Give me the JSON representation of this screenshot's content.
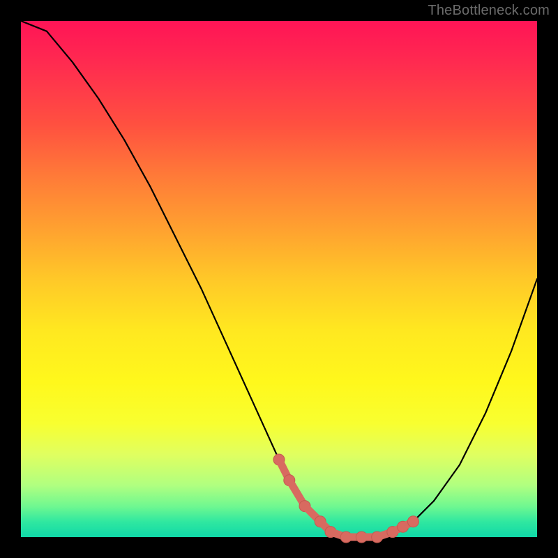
{
  "watermark": "TheBottleneck.com",
  "colors": {
    "frame": "#000000",
    "curve_black": "#000000",
    "marker": "#d86a60",
    "marker_stroke": "#c45a50"
  },
  "chart_data": {
    "type": "line",
    "title": "",
    "xlabel": "",
    "ylabel": "",
    "xlim": [
      0,
      100
    ],
    "ylim": [
      0,
      100
    ],
    "grid": false,
    "legend": false,
    "series": [
      {
        "name": "bottleneck-curve",
        "x": [
          0,
          5,
          10,
          15,
          20,
          25,
          30,
          35,
          40,
          45,
          50,
          52,
          55,
          58,
          60,
          63,
          65,
          68,
          72,
          76,
          80,
          85,
          90,
          95,
          100
        ],
        "values": [
          100,
          98,
          92,
          85,
          77,
          68,
          58,
          48,
          37,
          26,
          15,
          11,
          6,
          3,
          1,
          0,
          0,
          0,
          1,
          3,
          7,
          14,
          24,
          36,
          50
        ]
      }
    ],
    "markers": {
      "name": "highlight-range",
      "x": [
        50,
        52,
        55,
        58,
        60,
        63,
        66,
        69,
        72,
        74,
        76
      ],
      "values": [
        15,
        11,
        6,
        3,
        1,
        0,
        0,
        0,
        1,
        2,
        3
      ]
    }
  }
}
